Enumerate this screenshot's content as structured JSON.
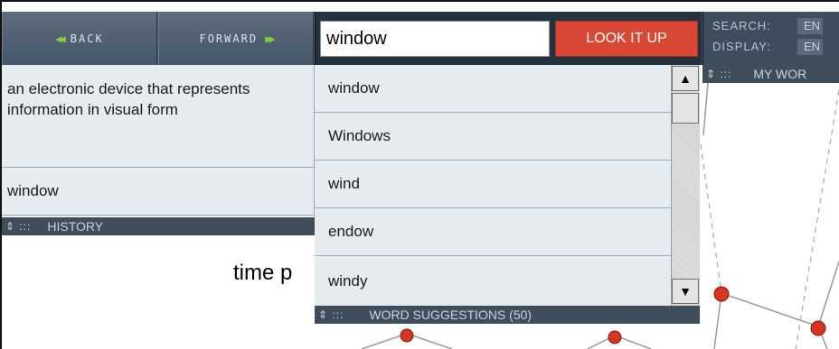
{
  "nav": {
    "back_label": "BACK",
    "forward_label": "FORWARD"
  },
  "search": {
    "value": "window",
    "lookup_label": "LOOK IT UP"
  },
  "languages": {
    "search_label": "SEARCH:",
    "search_value": "EN",
    "display_label": "DISPLAY:",
    "display_value": "EN"
  },
  "history": {
    "items": [
      "an electronic device that represents information in visual form",
      "window"
    ],
    "title": "HISTORY"
  },
  "my_words": {
    "title": "MY WOR"
  },
  "suggestions": {
    "items": [
      "window",
      "Windows",
      "wind",
      "endow",
      "windy"
    ],
    "title": "WORD SUGGESTIONS (50)"
  },
  "canvas": {
    "partial_label": "time p"
  },
  "colors": {
    "accent": "#d94735",
    "toolbar": "#4a5a6a",
    "panel_bar": "#404e5b",
    "node": "#d9341f"
  }
}
